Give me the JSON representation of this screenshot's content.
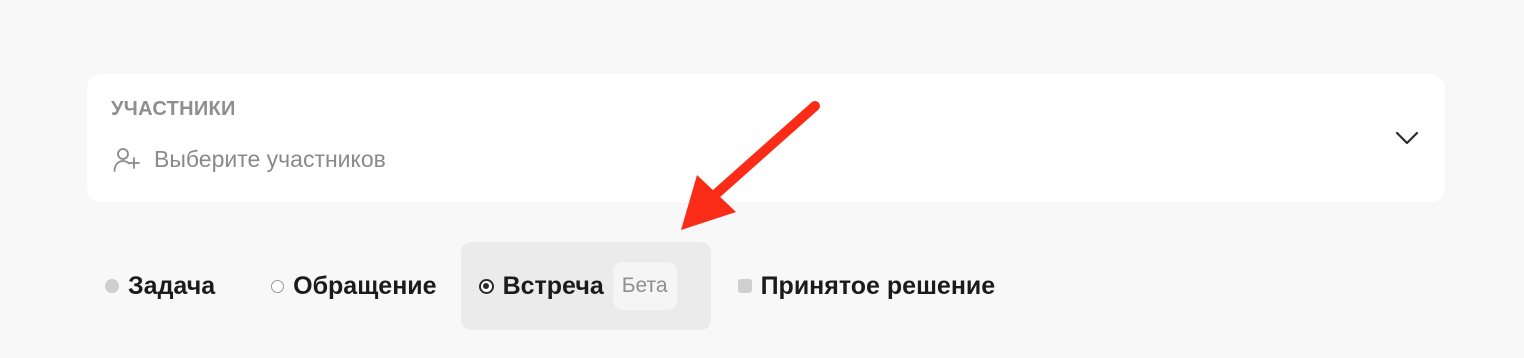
{
  "participants": {
    "label": "УЧАСТНИКИ",
    "placeholder": "Выберите участников",
    "icon": "user-plus-icon",
    "dropdown_icon": "chevron-down-icon"
  },
  "types": [
    {
      "label": "Задача",
      "marker": "dot-filled",
      "selected": false
    },
    {
      "label": "Обращение",
      "marker": "ring",
      "selected": false
    },
    {
      "label": "Встреча",
      "marker": "radio-selected",
      "selected": true,
      "badge": "Бета"
    },
    {
      "label": "Принятое решение",
      "marker": "square",
      "selected": false
    }
  ],
  "colors": {
    "annotation_arrow": "#fb2c17",
    "selected_background": "#ebebeb",
    "page_background": "#f8f8f8"
  }
}
